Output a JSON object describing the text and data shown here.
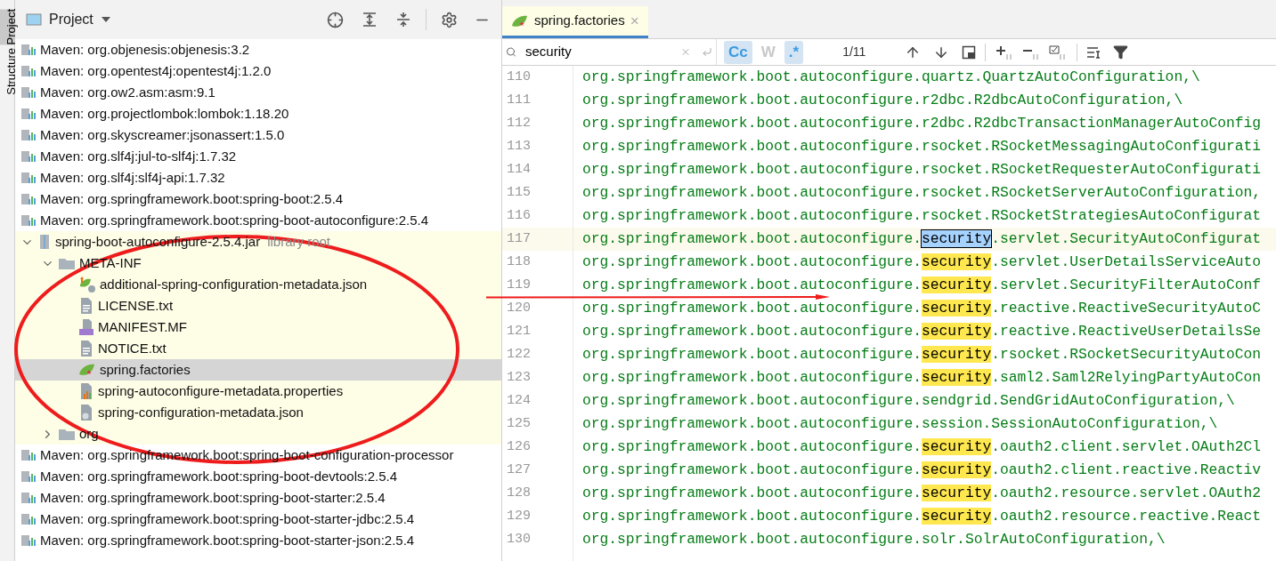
{
  "side_tabs": [
    {
      "label": "Project",
      "selected": true
    },
    {
      "label": "Structure",
      "selected": false
    }
  ],
  "project_panel": {
    "title": "Project",
    "tree": [
      {
        "kind": "library",
        "label": "Maven: org.objenesis:objenesis:3.2",
        "selected": false
      },
      {
        "kind": "library",
        "label": "Maven: org.opentest4j:opentest4j:1.2.0",
        "selected": false
      },
      {
        "kind": "library",
        "label": "Maven: org.ow2.asm:asm:9.1",
        "selected": false
      },
      {
        "kind": "library",
        "label": "Maven: org.projectlombok:lombok:1.18.20",
        "selected": false
      },
      {
        "kind": "library",
        "label": "Maven: org.skyscreamer:jsonassert:1.5.0",
        "selected": false
      },
      {
        "kind": "library",
        "label": "Maven: org.slf4j:jul-to-slf4j:1.7.32",
        "selected": false
      },
      {
        "kind": "library",
        "label": "Maven: org.slf4j:slf4j-api:1.7.32",
        "selected": false
      },
      {
        "kind": "library",
        "label": "Maven: org.springframework.boot:spring-boot:2.5.4",
        "selected": false
      },
      {
        "kind": "library",
        "label": "Maven: org.springframework.boot:spring-boot-autoconfigure:2.5.4",
        "selected": false,
        "children": [
          {
            "kind": "jar",
            "label": "spring-boot-autoconfigure-2.5.4.jar",
            "note": "library root",
            "selected": false,
            "expanded": true,
            "children": [
              {
                "kind": "folder",
                "label": "META-INF",
                "selected": false,
                "expanded": true,
                "children": [
                  {
                    "kind": "json-meta",
                    "label": "additional-spring-configuration-metadata.json",
                    "selected": false
                  },
                  {
                    "kind": "text",
                    "label": "LICENSE.txt",
                    "selected": false
                  },
                  {
                    "kind": "manifest",
                    "label": "MANIFEST.MF",
                    "selected": false
                  },
                  {
                    "kind": "text",
                    "label": "NOTICE.txt",
                    "selected": false
                  },
                  {
                    "kind": "spring",
                    "label": "spring.factories",
                    "selected": true
                  },
                  {
                    "kind": "properties",
                    "label": "spring-autoconfigure-metadata.properties",
                    "selected": false
                  },
                  {
                    "kind": "json-config",
                    "label": "spring-configuration-metadata.json",
                    "selected": false
                  }
                ]
              },
              {
                "kind": "folder",
                "label": "org",
                "selected": false,
                "expanded": false
              }
            ]
          }
        ]
      },
      {
        "kind": "library",
        "label": "Maven: org.springframework.boot:spring-boot-configuration-processor",
        "selected": false
      },
      {
        "kind": "library",
        "label": "Maven: org.springframework.boot:spring-boot-devtools:2.5.4",
        "selected": false
      },
      {
        "kind": "library",
        "label": "Maven: org.springframework.boot:spring-boot-starter:2.5.4",
        "selected": false
      },
      {
        "kind": "library",
        "label": "Maven: org.springframework.boot:spring-boot-starter-jdbc:2.5.4",
        "selected": false
      },
      {
        "kind": "library",
        "label": "Maven: org.springframework.boot:spring-boot-starter-json:2.5.4",
        "selected": false
      }
    ]
  },
  "editor_tabs": [
    {
      "label": "spring.factories",
      "selected": true,
      "close": "×"
    }
  ],
  "search_bar": {
    "value": "security",
    "match_case": {
      "label": "Cc",
      "selected": true
    },
    "words": {
      "label": "W",
      "selected": false
    },
    "regex": {
      "label": ".*",
      "selected": true
    },
    "count": "1/11"
  },
  "code_lines": [
    {
      "number": "110",
      "kind": "plain",
      "text": "org.springframework.boot.autoconfigure.quartz.QuartzAutoConfiguration,\\"
    },
    {
      "number": "111",
      "kind": "plain",
      "text": "org.springframework.boot.autoconfigure.r2dbc.R2dbcAutoConfiguration,\\"
    },
    {
      "number": "112",
      "kind": "plain",
      "text": "org.springframework.boot.autoconfigure.r2dbc.R2dbcTransactionManagerAutoConfig"
    },
    {
      "number": "113",
      "kind": "plain",
      "text": "org.springframework.boot.autoconfigure.rsocket.RSocketMessagingAutoConfigurati"
    },
    {
      "number": "114",
      "kind": "plain",
      "text": "org.springframework.boot.autoconfigure.rsocket.RSocketRequesterAutoConfigurati"
    },
    {
      "number": "115",
      "kind": "plain",
      "text": "org.springframework.boot.autoconfigure.rsocket.RSocketServerAutoConfiguration,"
    },
    {
      "number": "116",
      "kind": "plain",
      "text": "org.springframework.boot.autoconfigure.rsocket.RSocketStrategiesAutoConfigurat"
    },
    {
      "number": "117",
      "kind": "match",
      "before": "org.springframework.boot.autoconfigure.",
      "match": "security",
      "after": ".servlet.SecurityAutoConfigurat",
      "current": true
    },
    {
      "number": "118",
      "kind": "match",
      "before": "org.springframework.boot.autoconfigure.",
      "match": "security",
      "after": ".servlet.UserDetailsServiceAuto",
      "current": false
    },
    {
      "number": "119",
      "kind": "match",
      "before": "org.springframework.boot.autoconfigure.",
      "match": "security",
      "after": ".servlet.SecurityFilterAutoConf",
      "current": false
    },
    {
      "number": "120",
      "kind": "match",
      "before": "org.springframework.boot.autoconfigure.",
      "match": "security",
      "after": ".reactive.ReactiveSecurityAutoC",
      "current": false
    },
    {
      "number": "121",
      "kind": "match",
      "before": "org.springframework.boot.autoconfigure.",
      "match": "security",
      "after": ".reactive.ReactiveUserDetailsSe",
      "current": false
    },
    {
      "number": "122",
      "kind": "match",
      "before": "org.springframework.boot.autoconfigure.",
      "match": "security",
      "after": ".rsocket.RSocketSecurityAutoCon",
      "current": false
    },
    {
      "number": "123",
      "kind": "match",
      "before": "org.springframework.boot.autoconfigure.",
      "match": "security",
      "after": ".saml2.Saml2RelyingPartyAutoCon",
      "current": false
    },
    {
      "number": "124",
      "kind": "plain",
      "text": "org.springframework.boot.autoconfigure.sendgrid.SendGridAutoConfiguration,\\"
    },
    {
      "number": "125",
      "kind": "plain",
      "text": "org.springframework.boot.autoconfigure.session.SessionAutoConfiguration,\\"
    },
    {
      "number": "126",
      "kind": "match",
      "before": "org.springframework.boot.autoconfigure.",
      "match": "security",
      "after": ".oauth2.client.servlet.OAuth2Cl",
      "current": false
    },
    {
      "number": "127",
      "kind": "match",
      "before": "org.springframework.boot.autoconfigure.",
      "match": "security",
      "after": ".oauth2.client.reactive.Reactiv",
      "current": false
    },
    {
      "number": "128",
      "kind": "match",
      "before": "org.springframework.boot.autoconfigure.",
      "match": "security",
      "after": ".oauth2.resource.servlet.OAuth2",
      "current": false
    },
    {
      "number": "129",
      "kind": "match",
      "before": "org.springframework.boot.autoconfigure.",
      "match": "security",
      "after": ".oauth2.resource.reactive.React",
      "current": false
    },
    {
      "number": "130",
      "kind": "plain",
      "text": "org.springframework.boot.autoconfigure.solr.SolrAutoConfiguration,\\"
    }
  ]
}
